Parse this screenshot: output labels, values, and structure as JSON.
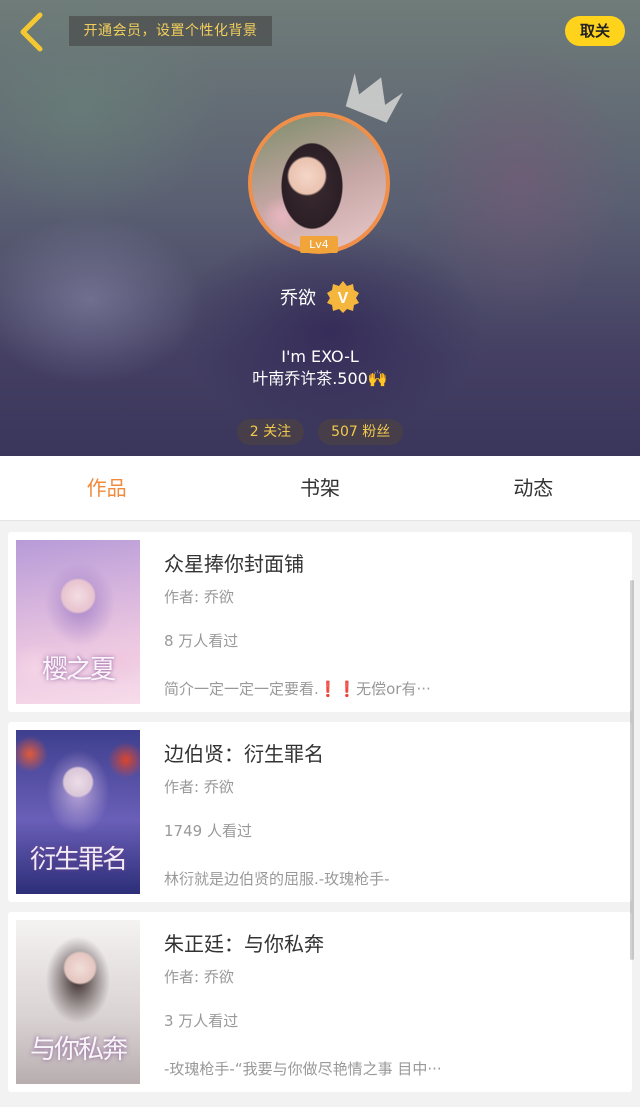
{
  "header": {
    "back_icon": "chevron-left-icon",
    "vip_banner": "开通会员，设置个性化背景",
    "unfollow_label": "取关",
    "level": "Lv4",
    "username": "乔欲",
    "verified_badge": "V",
    "bio_line1": "I'm EXO-L",
    "bio_line2": "叶南乔许茶.500🙌",
    "following": "2 关注",
    "followers": "507 粉丝"
  },
  "tabs": [
    {
      "label": "作品",
      "active": true
    },
    {
      "label": "书架",
      "active": false
    },
    {
      "label": "动态",
      "active": false
    }
  ],
  "works": [
    {
      "title": "众星捧你封面铺",
      "author": "作者: 乔欲",
      "views": "8 万人看过",
      "desc": "简介一定一定一定要看.❗❗无偿or有···",
      "cover_text": "樱之夏"
    },
    {
      "title": "边伯贤：衍生罪名",
      "author": "作者: 乔欲",
      "views": "1749 人看过",
      "desc": "林衍就是边伯贤的屈服.-玫瑰枪手-",
      "cover_text": "衍生罪名"
    },
    {
      "title": "朱正廷：与你私奔",
      "author": "作者: 乔欲",
      "views": "3 万人看过",
      "desc": "-玫瑰枪手-“我要与你做尽艳情之事 目中···",
      "cover_text": "与你私奔"
    }
  ],
  "colors": {
    "accent": "#f28a3c",
    "button_yellow": "#ffd21c",
    "banner_text": "#f2cf5b"
  }
}
